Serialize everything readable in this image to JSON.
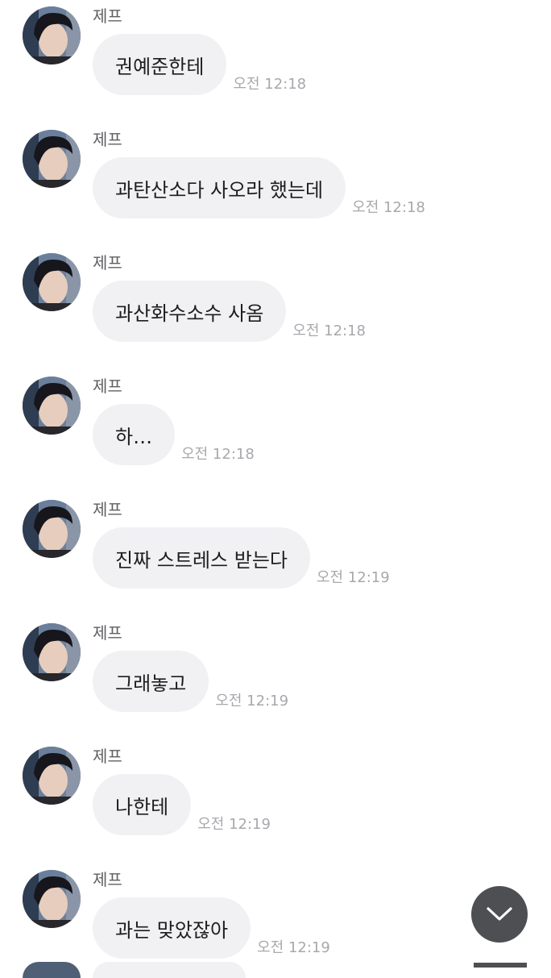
{
  "chat": {
    "messages": [
      {
        "sender": "제프",
        "text": "권예준한테",
        "time": "오전 12:18"
      },
      {
        "sender": "제프",
        "text": "과탄산소다 사오라 했는데",
        "time": "오전 12:18"
      },
      {
        "sender": "제프",
        "text": "과산화수소수 사옴",
        "time": "오전 12:18"
      },
      {
        "sender": "제프",
        "text": "하…",
        "time": "오전 12:18"
      },
      {
        "sender": "제프",
        "text": "진짜 스트레스 받는다",
        "time": "오전 12:19"
      },
      {
        "sender": "제프",
        "text": "그래놓고",
        "time": "오전 12:19"
      },
      {
        "sender": "제프",
        "text": "나한테",
        "time": "오전 12:19"
      },
      {
        "sender": "제프",
        "text": "과는 맞았잖아",
        "time": "오전 12:19"
      }
    ]
  },
  "icons": {
    "avatar": "profile-photo",
    "scroll_down": "chevron-down-icon"
  },
  "colors": {
    "bubble": "#f1f1f4",
    "scroll_button": "#4e4f53"
  }
}
